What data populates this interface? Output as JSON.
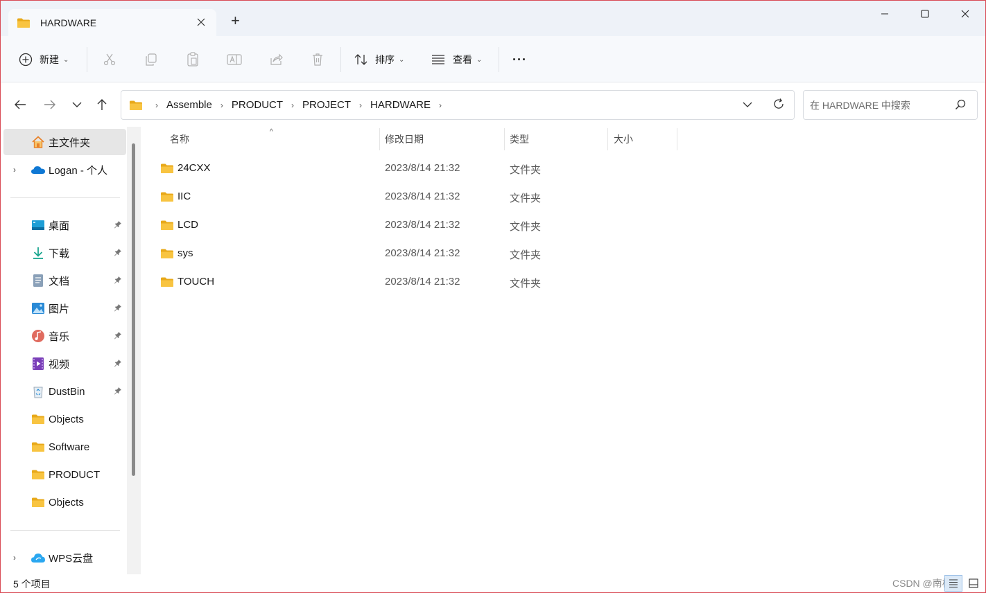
{
  "window": {
    "tab_title": "HARDWARE",
    "new_tab": "+"
  },
  "toolbar": {
    "new_label": "新建",
    "sort_label": "排序",
    "view_label": "查看",
    "more_label": "···"
  },
  "address": {
    "crumbs": [
      "Assemble",
      "PRODUCT",
      "PROJECT",
      "HARDWARE"
    ],
    "search_placeholder": "在 HARDWARE 中搜索"
  },
  "sidebar": {
    "home": "主文件夹",
    "onedrive": "Logan - 个人",
    "items": [
      {
        "label": "桌面",
        "icon": "desktop-icon"
      },
      {
        "label": "下载",
        "icon": "download-icon"
      },
      {
        "label": "文档",
        "icon": "document-icon"
      },
      {
        "label": "图片",
        "icon": "pictures-icon"
      },
      {
        "label": "音乐",
        "icon": "music-icon"
      },
      {
        "label": "视频",
        "icon": "video-icon"
      },
      {
        "label": "DustBin",
        "icon": "recycle-bin-icon"
      },
      {
        "label": "Objects",
        "icon": "folder-icon"
      },
      {
        "label": "Software",
        "icon": "folder-icon"
      },
      {
        "label": "PRODUCT",
        "icon": "folder-icon"
      },
      {
        "label": "Objects",
        "icon": "folder-icon"
      }
    ],
    "wps": "WPS云盘"
  },
  "columns": {
    "name": "名称",
    "modified": "修改日期",
    "type": "类型",
    "size": "大小"
  },
  "files": [
    {
      "name": "24CXX",
      "modified": "2023/8/14 21:32",
      "type": "文件夹"
    },
    {
      "name": "IIC",
      "modified": "2023/8/14 21:32",
      "type": "文件夹"
    },
    {
      "name": "LCD",
      "modified": "2023/8/14 21:32",
      "type": "文件夹"
    },
    {
      "name": "sys",
      "modified": "2023/8/14 21:32",
      "type": "文件夹"
    },
    {
      "name": "TOUCH",
      "modified": "2023/8/14 21:32",
      "type": "文件夹"
    }
  ],
  "status": {
    "count": "5 个项目",
    "watermark": "CSDN @南极熊"
  },
  "colors": {
    "folder": "#f8c441",
    "folder_dark": "#e8a91a",
    "accent": "#0067c0",
    "border": "#d94a54"
  }
}
